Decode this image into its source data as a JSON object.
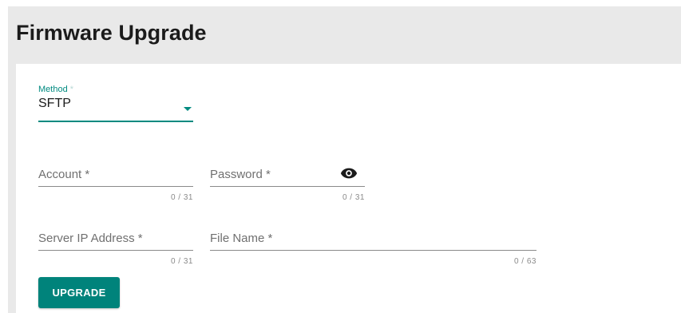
{
  "page": {
    "title": "Firmware Upgrade"
  },
  "form": {
    "method": {
      "label": "Method",
      "required_mark": "*",
      "value": "SFTP"
    },
    "account": {
      "label": "Account *",
      "counter": "0 / 31"
    },
    "password": {
      "label": "Password *",
      "counter": "0 / 31",
      "icon": "eye-icon"
    },
    "server_ip": {
      "label": "Server IP Address *",
      "counter": "0 / 31"
    },
    "file_name": {
      "label": "File Name *",
      "counter": "0 / 63"
    },
    "upgrade_button": {
      "label": "UPGRADE"
    }
  },
  "colors": {
    "accent": "#008a80",
    "button": "#00837b",
    "header_bg": "#e9e9e9"
  }
}
